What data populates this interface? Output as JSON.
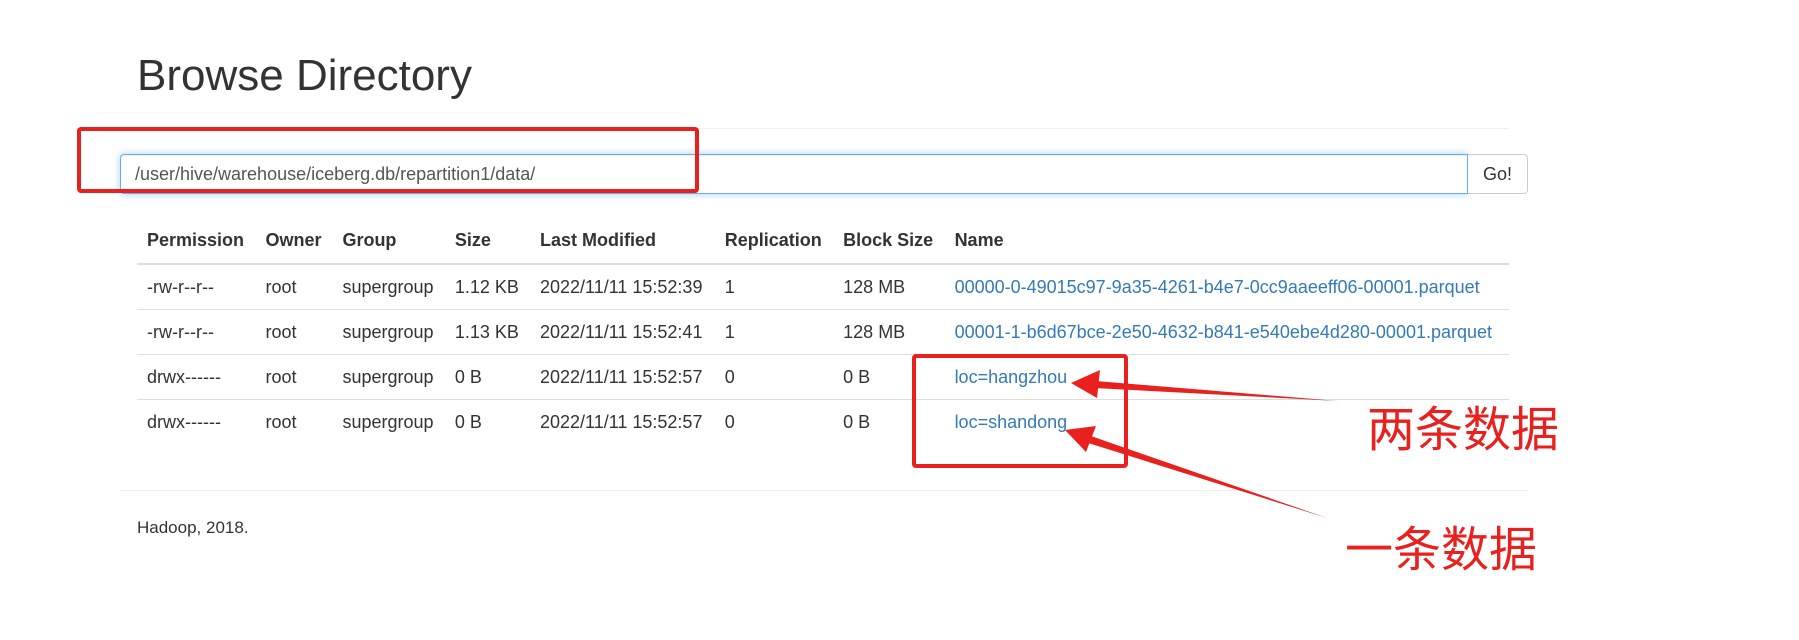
{
  "header": {
    "title": "Browse Directory"
  },
  "path_bar": {
    "value": "/user/hive/warehouse/iceberg.db/repartition1/data/",
    "go_label": "Go!"
  },
  "table": {
    "columns": [
      "Permission",
      "Owner",
      "Group",
      "Size",
      "Last Modified",
      "Replication",
      "Block Size",
      "Name"
    ],
    "rows": [
      {
        "permission": "-rw-r--r--",
        "owner": "root",
        "group": "supergroup",
        "size": "1.12 KB",
        "last_modified": "2022/11/11 15:52:39",
        "replication": "1",
        "block_size": "128 MB",
        "name": "00000-0-49015c97-9a35-4261-b4e7-0cc9aaeeff06-00001.parquet"
      },
      {
        "permission": "-rw-r--r--",
        "owner": "root",
        "group": "supergroup",
        "size": "1.13 KB",
        "last_modified": "2022/11/11 15:52:41",
        "replication": "1",
        "block_size": "128 MB",
        "name": "00001-1-b6d67bce-2e50-4632-b841-e540ebe4d280-00001.parquet"
      },
      {
        "permission": "drwx------",
        "owner": "root",
        "group": "supergroup",
        "size": "0 B",
        "last_modified": "2022/11/11 15:52:57",
        "replication": "0",
        "block_size": "0 B",
        "name": "loc=hangzhou"
      },
      {
        "permission": "drwx------",
        "owner": "root",
        "group": "supergroup",
        "size": "0 B",
        "last_modified": "2022/11/11 15:52:57",
        "replication": "0",
        "block_size": "0 B",
        "name": "loc=shandong"
      }
    ]
  },
  "footer": {
    "text": "Hadoop, 2018."
  },
  "annotations": {
    "label_two_rows": "两条数据",
    "label_one_row": "一条数据",
    "color": "#e8211f"
  },
  "colors": {
    "link": "#337ab7",
    "text": "#333333",
    "input_focus_border": "#66afe9"
  }
}
